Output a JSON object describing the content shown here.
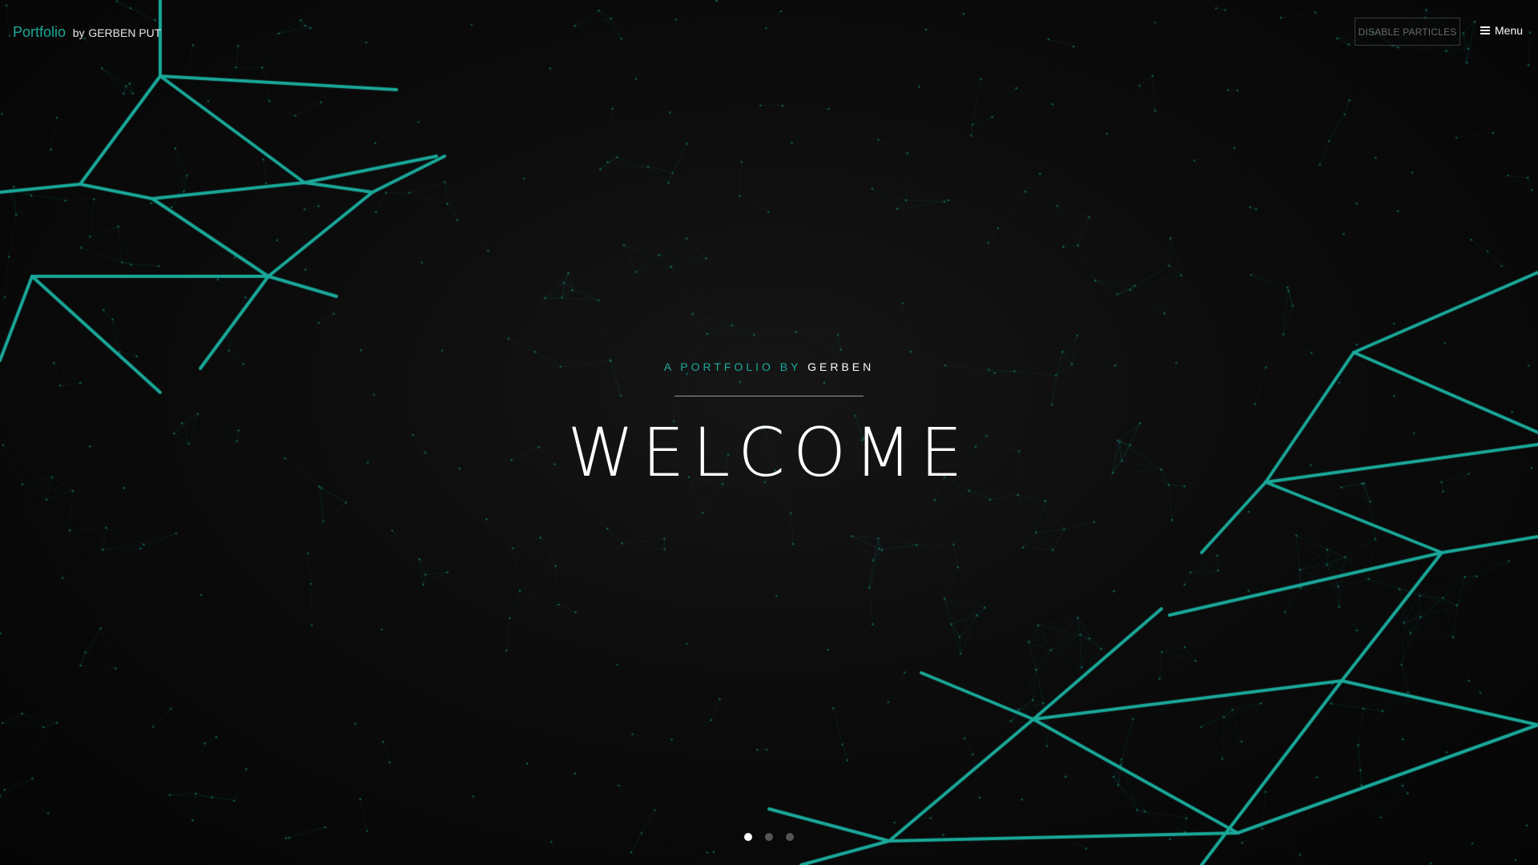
{
  "header": {
    "brand_word": "Portfolio",
    "brand_by": "by",
    "brand_name": "GERBEN PUT",
    "disable_particles_label": "DISABLE PARTICLES",
    "menu_label": "Menu"
  },
  "hero": {
    "kicker_prefix": "A PORTFOLIO BY ",
    "kicker_name": "GERBEN",
    "title": "WELCOME"
  },
  "slides": {
    "count": 3,
    "active_index": 0
  },
  "colors": {
    "accent": "#1aa99a",
    "background": "#050505",
    "text": "#ffffff"
  }
}
